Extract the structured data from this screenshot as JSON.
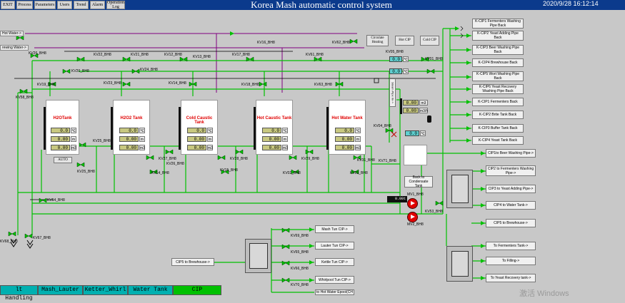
{
  "menu": [
    "EXIT",
    "Process",
    "Parameters",
    "Users",
    "Trend",
    "Alarm",
    "Operation Log"
  ],
  "title": "Korea  Mash automatic control system",
  "datetime": "2020/9/28 16:12:14",
  "inputs": {
    "hot_water": "Hot Water->",
    "brewing_water": "rewing Water->"
  },
  "top_buttons": [
    "Circulate Heating",
    "Hot CIP",
    "Cold CIP"
  ],
  "tanks": [
    {
      "name": "H2OTank",
      "t": "0.0",
      "l": "0.00",
      "v": "0.00"
    },
    {
      "name": "H2O2 Tank",
      "t": "0.0",
      "l": "0.00",
      "v": "0.00"
    },
    {
      "name": "Cold Caustic Tank",
      "t": "0.0",
      "l": "0.00",
      "v": "0.00"
    },
    {
      "name": "Hot Caustic Tank",
      "t": "0.0",
      "l": "0.00",
      "v": "0.00"
    },
    {
      "name": "Hot Water Tank",
      "t": "0.0",
      "l": "0.00",
      "v": "0.00"
    }
  ],
  "units": {
    "t": "℃",
    "l": "m",
    "v": "m3"
  },
  "auto_button": "AUTO",
  "cip_readouts": {
    "r1": "0.0",
    "r2": "0.0",
    "r1u": "℃",
    "r2u": "℃",
    "flow1": "0.00",
    "flow1u": "m3",
    "flow2": "0.00",
    "flow2u": "m3/h",
    "r3": "0.0",
    "r3u": "℃",
    "fm": "0.00",
    "fmu": "t"
  },
  "steam_label": "Steam Pipe I/n->",
  "back_condensate": "Back to Condensate Tank",
  "right_back": [
    "K-CIP1 Fermenters Washing Pipe Back",
    "K-CIP2  Yeast Adding Pipe Back",
    "K-CIP3     Beer Washing Pipe Back",
    "K-CIP4 Brewhouse Back",
    "K-CIP5     Wort Washing Pipe Back",
    "K-CIP6  Yeast Recovery Washing Pipe Back",
    "K-CIP1 Fermenters Back",
    "K-CIP2 Brite Tank Back",
    "K-CIP3 Buffer Tank Back",
    "K-CIP4 Yeast Tank Back"
  ],
  "right_out": [
    "CIP1to Beer Washing Pipe->",
    "CIP2 to Fermenters Washing Pipe->",
    "CIP3 to Yeast Adding Pipe->",
    "CIP4 to Water Tank->",
    "CIP5 to Brewhouse->"
  ],
  "right_out2": [
    "To Fermenters Tank->",
    "To Filling->",
    "To Yeast Recovery tank->"
  ],
  "bottom_out": [
    "Mash Tun CIP->",
    "Lauter Tun CIP->",
    "Kettle Tun CIP->",
    "Whirlpool Tun CIP->",
    "to Hot Water Epool(CH"
  ],
  "cip5_brewhouse": "CIP5 to Brewhouse->",
  "valves": [
    "KV26_BH8",
    "KV22_BH8",
    "KV21_BH8",
    "KV12_BH8",
    "KV11_BH8",
    "KV13_BH8",
    "KV17_BH8",
    "KV16_BH8",
    "KV61_BH8",
    "KV62_BH8",
    "KV05_BH8",
    "KV01_BH8",
    "KV20_BH8",
    "KV24_BH8",
    "KV23_BH8",
    "KV14_BH8",
    "KV18_BH8",
    "KV19_BH8",
    "KV63_BH8",
    "KV25_BH8",
    "KV58_BH8",
    "KV27_BH8",
    "KV26_BH8",
    "KV28_BH8",
    "KV29_BH8",
    "KV25_BH8",
    "KV31_BH8",
    "KV14_BH8",
    "KV15_BH8",
    "KV02_BH8",
    "KV03_BH8",
    "KV04_BH8",
    "KV57_BH8",
    "KV03_BH8",
    "KV64_BH8",
    "KV67_BH8",
    "KV68_BH8",
    "KV69_BH8",
    "KV65_BH8",
    "KV66_BH8",
    "KV70_BH8",
    "KV71_BH8",
    "KV52_BH8",
    "MV1_BH8",
    "MV2_BH8",
    "KV53_BH8",
    "KV54_BH8"
  ],
  "tabs": [
    "lt Handling",
    "Mash_Lauter",
    "Ketter_Whirl",
    "Water Tank",
    "CIP"
  ],
  "watermark": "激活 Windows",
  "colors": {
    "pipe_green": "#00c000",
    "pipe_purple": "#800080",
    "title_bar": "#0b3a8c",
    "tank_label": "#e00000",
    "tab": "#00b0b0",
    "tab_active": "#00c000"
  }
}
